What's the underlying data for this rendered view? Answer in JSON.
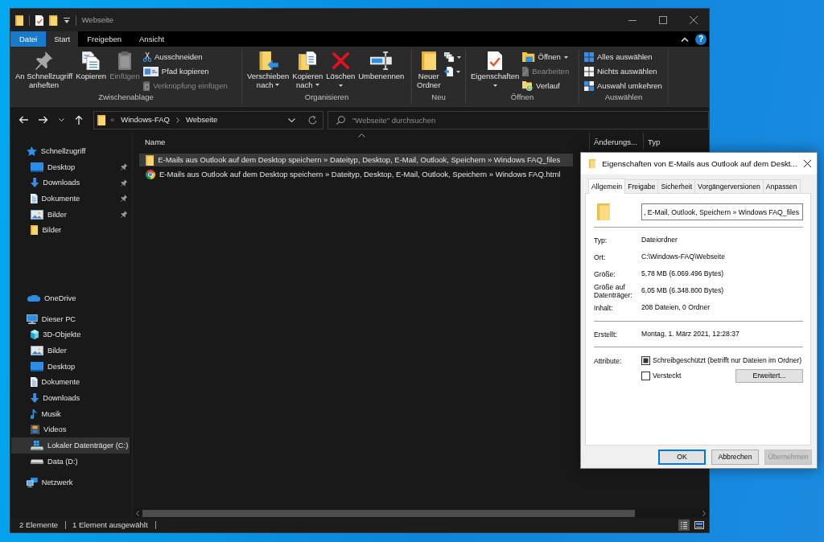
{
  "window": {
    "title": "Webseite"
  },
  "ribbon": {
    "tabs": [
      {
        "label": "Datei",
        "kind": "menu",
        "selected": false
      },
      {
        "label": "Start",
        "kind": "tab",
        "selected": true
      },
      {
        "label": "Freigeben",
        "kind": "tab",
        "selected": false
      },
      {
        "label": "Ansicht",
        "kind": "tab",
        "selected": false
      }
    ],
    "help": "?",
    "groups": [
      {
        "label": "Zwischenablage",
        "large": [
          {
            "kind": "pin",
            "label": "An Schnellzugriff\nanheften",
            "dropdown": false,
            "disabled": false
          },
          {
            "kind": "copy",
            "label": "Kopieren",
            "dropdown": false,
            "disabled": false
          },
          {
            "kind": "paste",
            "label": "Einfügen",
            "dropdown": false,
            "disabled": true
          }
        ],
        "small": [
          {
            "kind": "cut",
            "label": "Ausschneiden",
            "dropdown": false,
            "disabled": false
          },
          {
            "kind": "copypath",
            "label": "Pfad kopieren",
            "dropdown": false,
            "disabled": false
          },
          {
            "kind": "shortcut",
            "label": "Verknüpfung einfügen",
            "dropdown": false,
            "disabled": true
          }
        ]
      },
      {
        "label": "Organisieren",
        "large": [
          {
            "kind": "move",
            "label": "Verschieben\nnach",
            "dropdown": true,
            "disabled": false
          },
          {
            "kind": "copyto",
            "label": "Kopieren\nnach",
            "dropdown": true,
            "disabled": false
          },
          {
            "kind": "delete",
            "label": "Löschen",
            "dropdown": true,
            "disabled": false
          },
          {
            "kind": "rename",
            "label": "Umbenennen",
            "dropdown": false,
            "disabled": false
          }
        ]
      },
      {
        "label": "Neu",
        "large": [
          {
            "kind": "newfolder",
            "label": "Neuer\nOrdner",
            "dropdown": false,
            "disabled": false
          }
        ],
        "small": [
          {
            "kind": "newitem",
            "dropdown": true,
            "disabled": false
          },
          {
            "kind": "easyaccess",
            "dropdown": true,
            "disabled": false
          }
        ]
      },
      {
        "label": "Öffnen",
        "large": [
          {
            "kind": "properties",
            "label": "Eigenschaften",
            "dropdown": true,
            "disabled": false
          }
        ],
        "small": [
          {
            "kind": "open",
            "label": "Öffnen",
            "dropdown": true,
            "disabled": false
          },
          {
            "kind": "edit",
            "label": "Bearbeiten",
            "dropdown": false,
            "disabled": true
          },
          {
            "kind": "history",
            "label": "Verlauf",
            "dropdown": false,
            "disabled": false
          }
        ]
      },
      {
        "label": "Auswählen",
        "small": [
          {
            "kind": "selectall",
            "label": "Alles auswählen",
            "dropdown": false,
            "disabled": false
          },
          {
            "kind": "selectnone",
            "label": "Nichts auswählen",
            "dropdown": false,
            "disabled": false
          },
          {
            "kind": "invert",
            "label": "Auswahl umkehren",
            "dropdown": false,
            "disabled": false
          }
        ]
      }
    ]
  },
  "address_bar": {
    "overflow": "«",
    "crumbs": [
      "Windows-FAQ",
      "Webseite"
    ]
  },
  "search": {
    "placeholder": "\"Webseite\" durchsuchen"
  },
  "navigation": [
    {
      "label": "Schnellzugriff",
      "kind": "star",
      "selected": false,
      "children": [
        {
          "label": "Desktop",
          "kind": "desktop",
          "selected": false,
          "pinned": true
        },
        {
          "label": "Downloads",
          "kind": "downloads",
          "selected": false,
          "pinned": true
        },
        {
          "label": "Dokumente",
          "kind": "documents",
          "selected": false,
          "pinned": true
        },
        {
          "label": "Bilder",
          "kind": "pictures",
          "selected": false,
          "pinned": true
        },
        {
          "label": "Bilder",
          "kind": "folder",
          "selected": false,
          "pinned": false
        }
      ]
    },
    {
      "label": "OneDrive",
      "kind": "cloud",
      "selected": false
    },
    {
      "label": "Dieser PC",
      "kind": "computer",
      "selected": false,
      "children": [
        {
          "label": "3D-Objekte",
          "kind": "cube",
          "selected": false
        },
        {
          "label": "Bilder",
          "kind": "pictures",
          "selected": false
        },
        {
          "label": "Desktop",
          "kind": "desktop",
          "selected": false
        },
        {
          "label": "Dokumente",
          "kind": "documents",
          "selected": false
        },
        {
          "label": "Downloads",
          "kind": "downloads",
          "selected": false
        },
        {
          "label": "Musik",
          "kind": "music",
          "selected": false
        },
        {
          "label": "Videos",
          "kind": "videos",
          "selected": false
        },
        {
          "label": "Lokaler Datenträger (C:)",
          "kind": "systemdrive",
          "selected": true
        },
        {
          "label": "Data (D:)",
          "kind": "drive",
          "selected": false
        }
      ]
    },
    {
      "label": "Netzwerk",
      "kind": "network",
      "selected": false
    }
  ],
  "file_list": {
    "columns": [
      {
        "label": "Name",
        "sorted": true
      },
      {
        "label": "Änderungs...",
        "sorted": false
      },
      {
        "label": "Typ",
        "sorted": false
      }
    ],
    "rows": [
      {
        "name": "E-Mails aus Outlook auf dem Desktop speichern » Dateityp, Desktop, E-Mail, Outlook, Speichern » Windows FAQ_files",
        "kind": "folder",
        "selected": true
      },
      {
        "name": "E-Mails aus Outlook auf dem Desktop speichern » Dateityp, Desktop, E-Mail, Outlook, Speichern » Windows FAQ.html",
        "kind": "webpage",
        "selected": false
      }
    ]
  },
  "status_bar": {
    "items": [
      "2 Elemente",
      "1 Element ausgewählt"
    ],
    "views": [
      {
        "kind": "details",
        "selected": true
      },
      {
        "kind": "tiles",
        "selected": false
      }
    ]
  },
  "dialog": {
    "title": "Eigenschaften von E-Mails aus Outlook auf dem Deskt...",
    "tabs": [
      {
        "label": "Allgemein",
        "selected": true
      },
      {
        "label": "Freigabe",
        "selected": false
      },
      {
        "label": "Sicherheit",
        "selected": false
      },
      {
        "label": "Vorgängerversionen",
        "selected": false
      },
      {
        "label": "Anpassen",
        "selected": false
      }
    ],
    "name_field": {
      "value": ", E-Mail, Outlook, Speichern » Windows FAQ_files"
    },
    "sections": [
      {
        "rows": [
          {
            "label": "Typ:",
            "value": "Dateiordner"
          },
          {
            "label": "Ort:",
            "value": "C:\\Windows-FAQ\\Webseite"
          },
          {
            "label": "Größe:",
            "value": "5,78 MB (6.069.496 Bytes)"
          },
          {
            "label": "Größe auf Datenträger:",
            "value": "6,05 MB (6.348.800 Bytes)"
          },
          {
            "label": "Inhalt:",
            "value": "208 Dateien, 0 Ordner"
          }
        ]
      },
      {
        "rows": [
          {
            "label": "Erstellt:",
            "value": "Montag, 1. März 2021, 12:28:37"
          }
        ]
      }
    ],
    "attributes": {
      "label": "Attribute:",
      "checkboxes": [
        {
          "label": "Schreibgeschützt (betrifft nur Dateien im Ordner)",
          "checked": false,
          "indeterminate": true
        },
        {
          "label": "Versteckt",
          "checked": false,
          "indeterminate": false
        }
      ],
      "button": "Erweitert..."
    },
    "buttons": [
      {
        "label": "OK",
        "default": true,
        "disabled": false
      },
      {
        "label": "Abbrechen",
        "default": false,
        "disabled": false
      },
      {
        "label": "Übernehmen",
        "default": false,
        "disabled": true
      }
    ]
  }
}
